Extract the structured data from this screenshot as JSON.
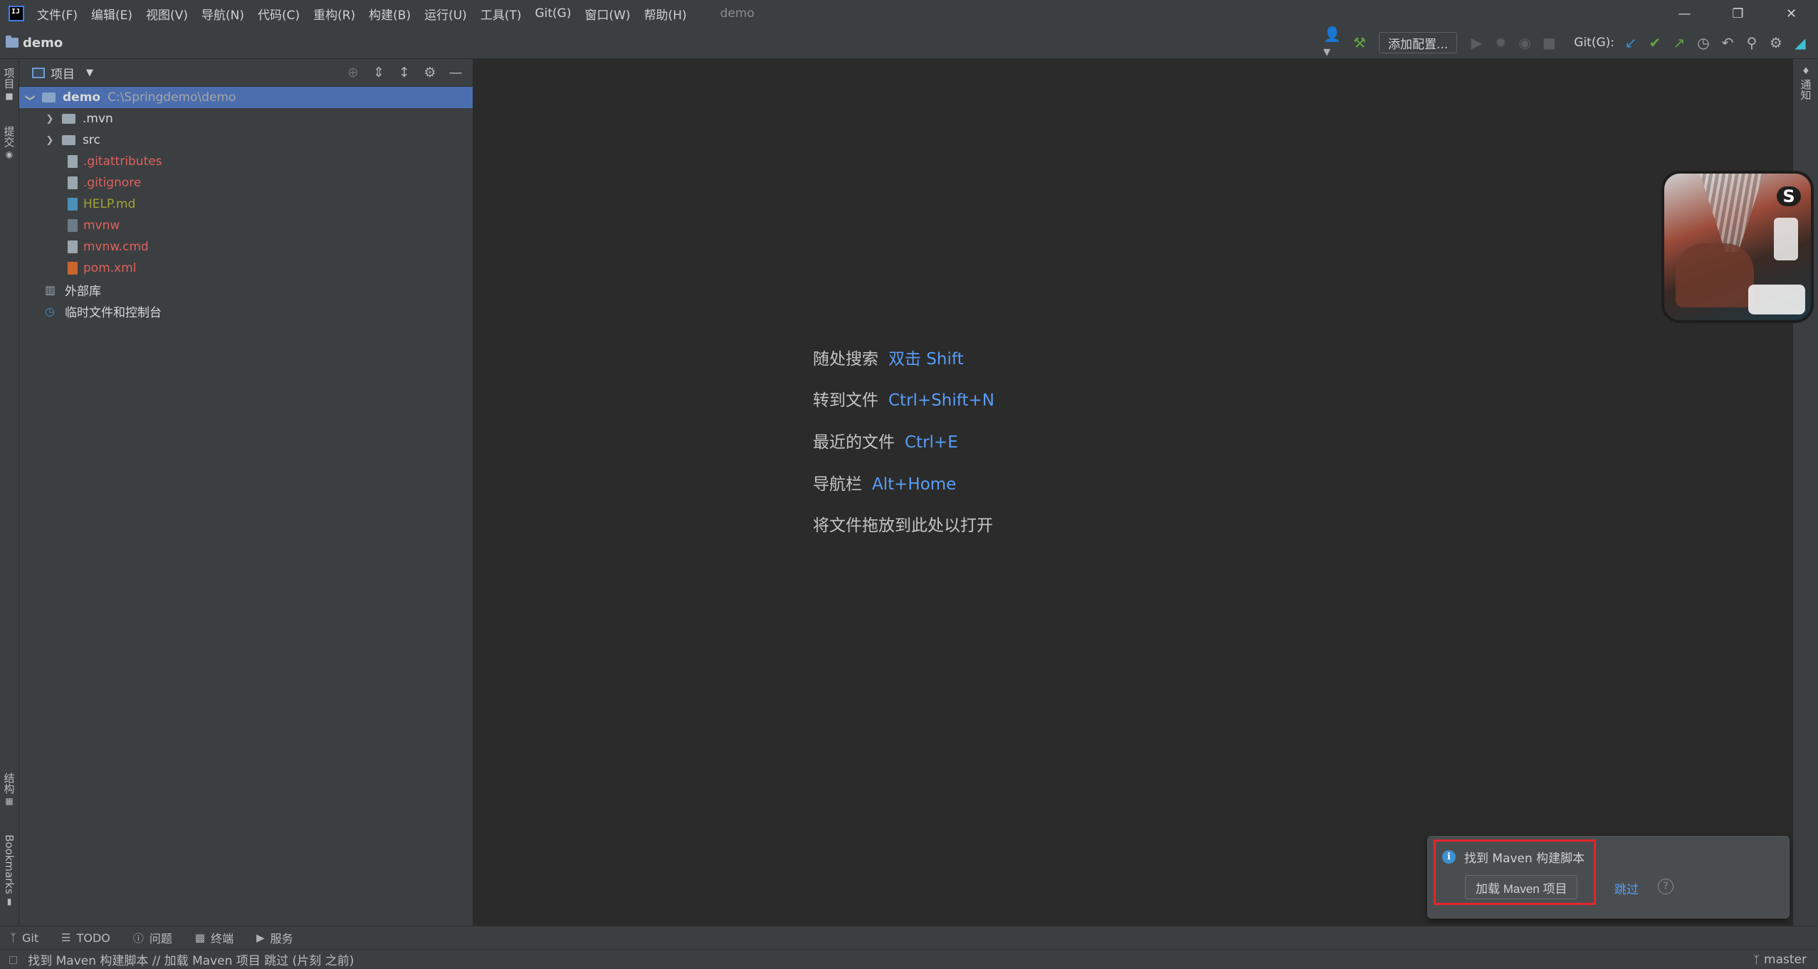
{
  "app": {
    "window_title": "demo",
    "logo_text": "IJ",
    "menu": [
      "文件(F)",
      "编辑(E)",
      "视图(V)",
      "导航(N)",
      "代码(C)",
      "重构(R)",
      "构建(B)",
      "运行(U)",
      "工具(T)",
      "Git(G)",
      "窗口(W)",
      "帮助(H)"
    ]
  },
  "navbar": {
    "breadcrumb": "demo",
    "add_config": "添加配置...",
    "git_label": "Git(G):"
  },
  "left_strip": {
    "project_tab": "项目",
    "commit_tab": "提交",
    "structure_tab": "结构",
    "bookmarks_tab": "Bookmarks"
  },
  "right_strip": {
    "notifications_tab": "通知"
  },
  "project_panel": {
    "title": "项目",
    "root": {
      "name": "demo",
      "path": "C:\\Springdemo\\demo"
    },
    "folders": [
      ".mvn",
      "src"
    ],
    "files": [
      {
        "name": ".gitattributes",
        "color": "#e0605c"
      },
      {
        "name": ".gitignore",
        "color": "#e0605c"
      },
      {
        "name": "HELP.md",
        "color": "#a3a337"
      },
      {
        "name": "mvnw",
        "color": "#e0605c"
      },
      {
        "name": "mvnw.cmd",
        "color": "#e0605c"
      },
      {
        "name": "pom.xml",
        "color": "#e0605c"
      }
    ],
    "external_libs": "外部库",
    "scratches": "临时文件和控制台"
  },
  "editor": {
    "hints": [
      {
        "label": "随处搜索",
        "key": "双击 Shift"
      },
      {
        "label": "转到文件",
        "key": "Ctrl+Shift+N"
      },
      {
        "label": "最近的文件",
        "key": "Ctrl+E"
      },
      {
        "label": "导航栏",
        "key": "Alt+Home"
      },
      {
        "label": "将文件拖放到此处以打开",
        "key": ""
      }
    ]
  },
  "notification": {
    "title": "找到 Maven 构建脚本",
    "load_button": "加载 Maven 项目",
    "skip": "跳过",
    "help": "?"
  },
  "bottom_tools": [
    "Git",
    "TODO",
    "问题",
    "终端",
    "服务"
  ],
  "status": {
    "message": "找到 Maven 构建脚本 // 加载 Maven 项目   跳过 (片刻 之前)",
    "branch": "master"
  },
  "colors": {
    "accent": "#4b6eaf",
    "link": "#589df6",
    "highlight_border": "#e3262e"
  }
}
